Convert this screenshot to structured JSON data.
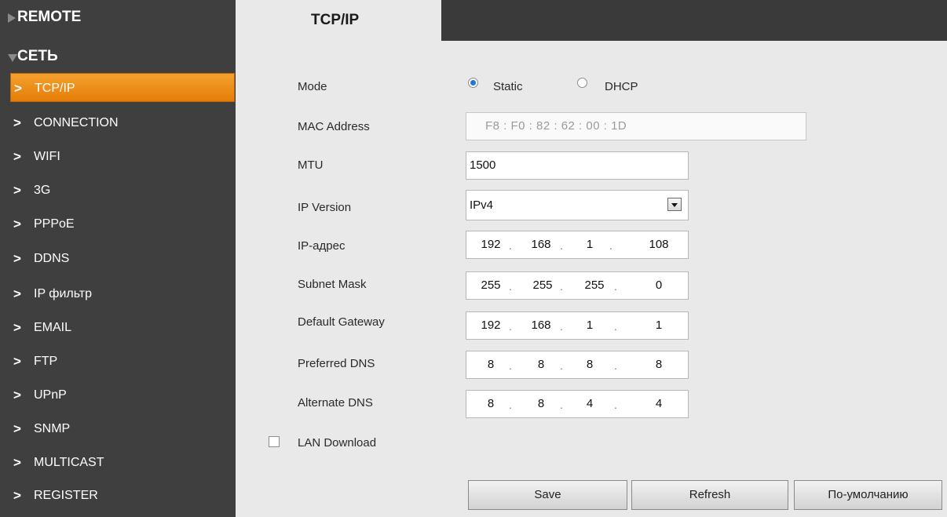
{
  "sidebar": {
    "remote_label": "REMOTE",
    "network_label": "СЕТЬ",
    "items": [
      {
        "label": "TCP/IP"
      },
      {
        "label": "CONNECTION"
      },
      {
        "label": "WIFI"
      },
      {
        "label": "3G"
      },
      {
        "label": "PPPoE"
      },
      {
        "label": "DDNS"
      },
      {
        "label": "IP фильтр"
      },
      {
        "label": "EMAIL"
      },
      {
        "label": "FTP"
      },
      {
        "label": "UPnP"
      },
      {
        "label": "SNMP"
      },
      {
        "label": "MULTICAST"
      },
      {
        "label": "REGISTER"
      }
    ],
    "chevron": ">"
  },
  "tab": {
    "title": "TCP/IP"
  },
  "form": {
    "mode_label": "Mode",
    "mode_static": "Static",
    "mode_dhcp": "DHCP",
    "mac_label": "MAC Address",
    "mac_value": "F8  :  F0  :  82  :  62  :  00  :  1D",
    "mtu_label": "MTU",
    "mtu_value": "1500",
    "ipver_label": "IP Version",
    "ipver_value": "IPv4",
    "ip_label": "IP-адрес",
    "ip": [
      "192",
      "168",
      "1",
      "108"
    ],
    "mask_label": "Subnet Mask",
    "mask": [
      "255",
      "255",
      "255",
      "0"
    ],
    "gw_label": "Default Gateway",
    "gw": [
      "192",
      "168",
      "1",
      "1"
    ],
    "dns1_label": "Preferred DNS",
    "dns1": [
      "8",
      "8",
      "8",
      "8"
    ],
    "dns2_label": "Alternate DNS",
    "dns2": [
      "8",
      "8",
      "4",
      "4"
    ],
    "lan_label": "LAN Download",
    "dot": "."
  },
  "buttons": {
    "save": "Save",
    "refresh": "Refresh",
    "default": "По-умолчанию"
  }
}
